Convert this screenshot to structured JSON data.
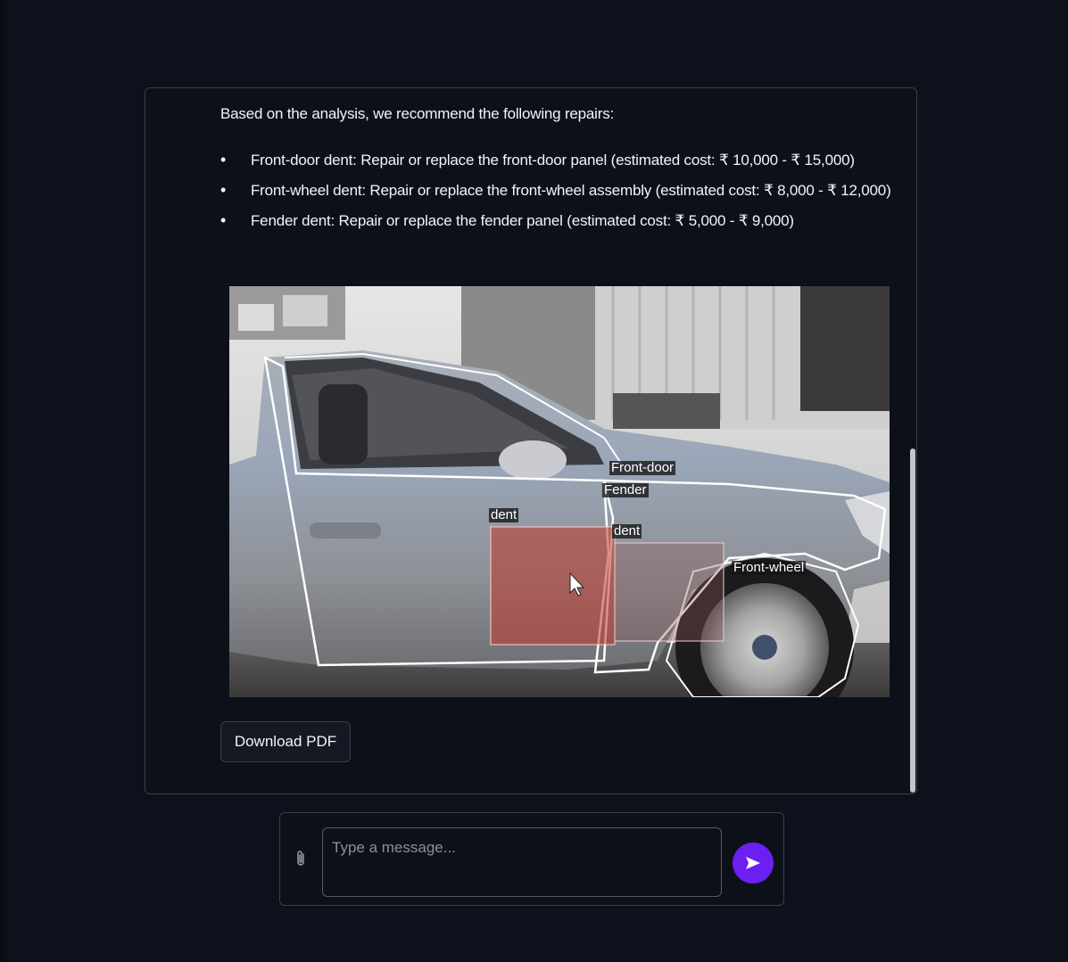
{
  "chat": {
    "intro": "Based on the analysis, we recommend the following repairs:",
    "repairs": [
      "Front-door dent: Repair or replace the front-door panel (estimated cost: ₹ 10,000 - ₹ 15,000)",
      "Front-wheel dent: Repair or replace the front-wheel assembly (estimated cost: ₹ 8,000 - ₹ 12,000)",
      "Fender dent: Repair or replace the fender panel (estimated cost: ₹ 5,000 - ₹ 9,000)"
    ],
    "image_labels": {
      "front_door": "Front-door",
      "fender": "Fender",
      "dent_1": "dent",
      "dent_2": "dent",
      "front_wheel": "Front-wheel"
    },
    "download_label": "Download PDF"
  },
  "composer": {
    "placeholder": "Type a message...",
    "attach_icon": "paperclip-icon",
    "send_icon": "send-arrow-icon"
  },
  "colors": {
    "background": "#0d111b",
    "send_button": "#6b1ff0",
    "dent_highlight": "#c0392b"
  }
}
